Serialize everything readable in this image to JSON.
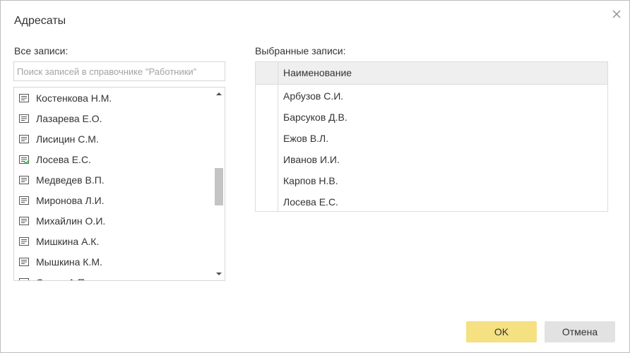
{
  "dialog": {
    "title": "Адресаты",
    "close_icon": "close-icon"
  },
  "left_panel": {
    "label": "Все записи:",
    "search_placeholder": "Поиск записей в справочнике \"Работники\"",
    "items": [
      {
        "name": "Костенкова Н.М.",
        "icon": "record-icon"
      },
      {
        "name": "Лазарева Е.О.",
        "icon": "record-icon"
      },
      {
        "name": "Лисицин С.М.",
        "icon": "record-icon"
      },
      {
        "name": "Лосева Е.С.",
        "icon": "record-selected-icon"
      },
      {
        "name": "Медведев В.П.",
        "icon": "record-icon"
      },
      {
        "name": "Миронова Л.И.",
        "icon": "record-icon"
      },
      {
        "name": "Михайлин О.И.",
        "icon": "record-icon"
      },
      {
        "name": "Мишкина А.К.",
        "icon": "record-icon"
      },
      {
        "name": "Мышкина К.М.",
        "icon": "record-icon"
      },
      {
        "name": "Орлов А.П.",
        "icon": "record-icon"
      }
    ]
  },
  "right_panel": {
    "label": "Выбранные записи:",
    "column_header": "Наименование",
    "rows": [
      "Арбузов С.И.",
      "Барсуков Д.В.",
      "Ежов В.Л.",
      "Иванов И.И.",
      "Карпов Н.В.",
      "Лосева Е.С."
    ]
  },
  "buttons": {
    "ok": "OK",
    "cancel": "Отмена"
  },
  "colors": {
    "ok_button": "#f5e082",
    "cancel_button": "#e2e2e2",
    "check_mark": "#3bb54a",
    "icon_stroke": "#555555"
  }
}
